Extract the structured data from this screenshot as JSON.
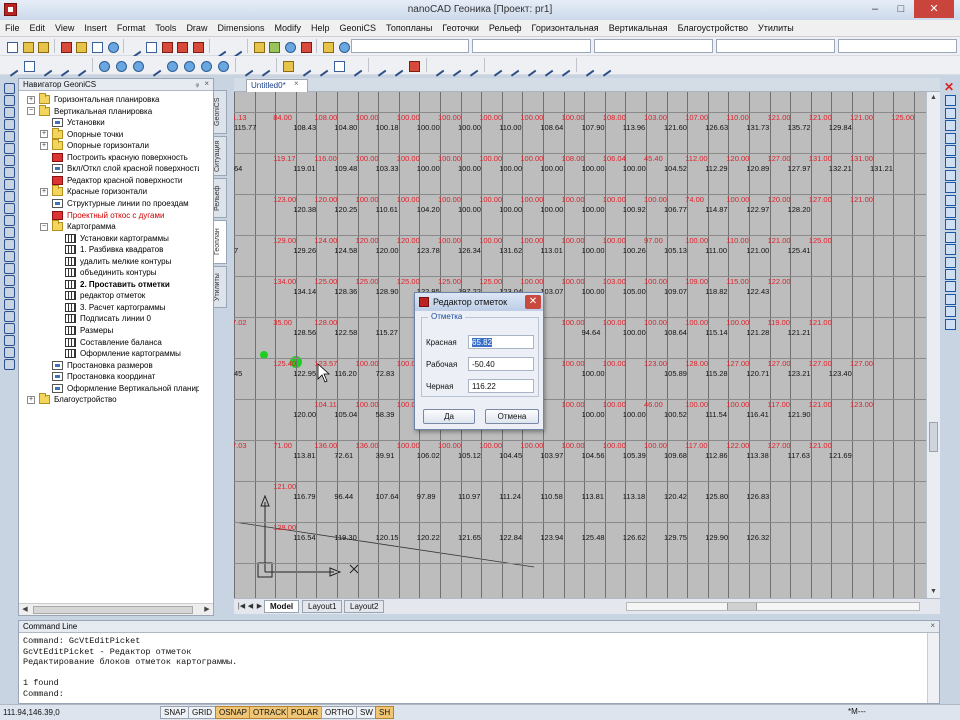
{
  "window": {
    "title": "nanoCAD Геоника [Проект: pr1]",
    "minimize": "–",
    "maximize": "□",
    "close": "✕"
  },
  "menu": [
    "File",
    "Edit",
    "View",
    "Insert",
    "Format",
    "Tools",
    "Draw",
    "Dimensions",
    "Modify",
    "Help",
    "GeoniCS",
    "Топопланы",
    "Геоточки",
    "Рельеф",
    "Горизонтальная",
    "Вертикальная",
    "Благоустройство",
    "Утилиты"
  ],
  "navigator": {
    "title": "Навигатор GeoniCS",
    "pin": "ᵩ",
    "close": "×",
    "items": [
      {
        "label": "Горизонтальная планировка",
        "level": 0,
        "exp": "+",
        "icon": "folder"
      },
      {
        "label": "Вертикальная планировка",
        "level": 0,
        "exp": "−",
        "icon": "folder"
      },
      {
        "label": "Установки",
        "level": 1,
        "exp": "",
        "icon": "tool"
      },
      {
        "label": "Опорные точки",
        "level": 1,
        "exp": "+",
        "icon": "folder"
      },
      {
        "label": "Опорные горизонтали",
        "level": 1,
        "exp": "+",
        "icon": "folder"
      },
      {
        "label": "Построить красную поверхность",
        "level": 1,
        "exp": "",
        "icon": "red"
      },
      {
        "label": "Вкл/Откл слой красной поверхности",
        "level": 1,
        "exp": "",
        "icon": "tool"
      },
      {
        "label": "Редактор красной поверхности",
        "level": 1,
        "exp": "",
        "icon": "red"
      },
      {
        "label": "Красные горизонтали",
        "level": 1,
        "exp": "+",
        "icon": "folder"
      },
      {
        "label": "Структурные линии по проездам",
        "level": 1,
        "exp": "",
        "icon": "tool"
      },
      {
        "label": "Проектный откос с дугами",
        "level": 1,
        "exp": "",
        "icon": "red",
        "style": "red"
      },
      {
        "label": "Картограмма",
        "level": 1,
        "exp": "−",
        "icon": "folder"
      },
      {
        "label": "Установки картограммы",
        "level": 2,
        "exp": "",
        "icon": "grid"
      },
      {
        "label": "1. Разбивка квадратов",
        "level": 2,
        "exp": "",
        "icon": "grid"
      },
      {
        "label": "удалить мелкие контуры",
        "level": 2,
        "exp": "",
        "icon": "grid"
      },
      {
        "label": "объединить контуры",
        "level": 2,
        "exp": "",
        "icon": "grid"
      },
      {
        "label": "2. Проставить отметки",
        "level": 2,
        "exp": "",
        "icon": "grid",
        "style": "selected"
      },
      {
        "label": "редактор отметок",
        "level": 2,
        "exp": "",
        "icon": "grid"
      },
      {
        "label": "3. Расчет картограммы",
        "level": 2,
        "exp": "",
        "icon": "grid"
      },
      {
        "label": "Подписать линии 0",
        "level": 2,
        "exp": "",
        "icon": "grid"
      },
      {
        "label": "Размеры",
        "level": 2,
        "exp": "",
        "icon": "grid"
      },
      {
        "label": "Составление баланса",
        "level": 2,
        "exp": "",
        "icon": "grid"
      },
      {
        "label": "Оформление картограммы",
        "level": 2,
        "exp": "",
        "icon": "grid"
      },
      {
        "label": "Простановка размеров",
        "level": 1,
        "exp": "",
        "icon": "tool"
      },
      {
        "label": "Простановка координат",
        "level": 1,
        "exp": "",
        "icon": "tool"
      },
      {
        "label": "Оформление Вертикальной планиров",
        "level": 1,
        "exp": "",
        "icon": "tool"
      },
      {
        "label": "Благоустройство",
        "level": 0,
        "exp": "+",
        "icon": "folder"
      }
    ]
  },
  "side_tabs": [
    "GeoniCS",
    "Ситуация",
    "Рельеф",
    "Геоплан",
    "Утилиты"
  ],
  "document_tab": {
    "label": "Untitled0*",
    "close": "×"
  },
  "layout_tabs": [
    "Model",
    "Layout1",
    "Layout2"
  ],
  "nav_arrows": [
    "|◀",
    "◀",
    "▶",
    "▶|"
  ],
  "grid": {
    "rows": [
      {
        "red": [
          "1.13",
          "84.00",
          "108.00",
          "100.00",
          "100.00",
          "100.00",
          "100.00",
          "100.00",
          "100.00",
          "108.00",
          "103.00",
          "107.00",
          "110.00",
          "121.00",
          "121.00",
          "121.00",
          "125.00"
        ],
        "blk": [
          "115.77",
          "108.43",
          "104.80",
          "100.18",
          "100.00",
          "100.00",
          "110.00",
          "108.64",
          "107.90",
          "113.96",
          "121.60",
          "126.63",
          "131.73",
          "135.72",
          "129.84"
        ]
      },
      {
        "red": [
          "",
          "119.17",
          "116.00",
          "100.00",
          "100.00",
          "100.00",
          "100.00",
          "100.00",
          "108.00",
          "106.04",
          "45.40",
          "112.00",
          "120.00",
          "127.00",
          "131.00",
          "131.00"
        ],
        "blk": [
          "64",
          "119.01",
          "109.48",
          "103.33",
          "100.00",
          "100.00",
          "100.00",
          "100.00",
          "100.00",
          "100.00",
          "104.52",
          "112.29",
          "120.89",
          "127.97",
          "132.21",
          "131.21"
        ]
      },
      {
        "red": [
          "",
          "123.00",
          "120.00",
          "100.00",
          "100.00",
          "100.00",
          "100.00",
          "100.00",
          "100.00",
          "100.00",
          "100.00",
          "74.00",
          "100.00",
          "120.00",
          "127.00",
          "121.00"
        ],
        "blk": [
          "",
          "120.38",
          "120.25",
          "110.61",
          "104.20",
          "100.00",
          "100.00",
          "100.00",
          "100.00",
          "100.92",
          "106.77",
          "114.87",
          "122.97",
          "128.20"
        ]
      },
      {
        "red": [
          "",
          "129.00",
          "124.00",
          "120.00",
          "120.00",
          "100.00",
          "100.00",
          "100.00",
          "100.00",
          "100.00",
          "97.00",
          "100.00",
          "110.00",
          "121.00",
          "125.00"
        ],
        "blk": [
          "7",
          "129.26",
          "124.58",
          "120.00",
          "123.78",
          "126.34",
          "131.62",
          "113.01",
          "100.00",
          "100.26",
          "105.13",
          "111.00",
          "121.00",
          "125.41"
        ]
      },
      {
        "red": [
          "",
          "134.00",
          "125.00",
          "125.00",
          "125.00",
          "125.00",
          "125.00",
          "100.00",
          "100.00",
          "103.00",
          "100.00",
          "109.00",
          "115.00",
          "122.00"
        ],
        "blk": [
          "",
          "134.14",
          "128.36",
          "128.90",
          "122.95",
          "197.22",
          "123.04",
          "103.07",
          "100.00",
          "105.00",
          "109.07",
          "118.82",
          "122.43"
        ]
      },
      {
        "red": [
          "7.02",
          "35.00",
          "128.00",
          "",
          "",
          "",
          "",
          "",
          "100.00",
          "100.00",
          "100.00",
          "100.00",
          "100.00",
          "119.00",
          "121.00"
        ],
        "blk": [
          "",
          "128.56",
          "122.58",
          "115.27",
          "",
          "",
          "",
          "",
          "94.64",
          "100.00",
          "108.64",
          "115.14",
          "121.28",
          "121.21"
        ]
      },
      {
        "red": [
          "",
          "125.40",
          "123.57",
          "100.00",
          "100.00",
          "100.00",
          "",
          "",
          "100.00",
          "100.00",
          "123.00",
          "128.00",
          "127.00",
          "127.00",
          "127.00",
          "127.00"
        ],
        "blk": [
          "45",
          "122.95",
          "116.20",
          "72.83",
          "",
          "",
          "",
          "",
          "100.00",
          "",
          "105.89",
          "115.28",
          "120.71",
          "123.21",
          "123.40"
        ]
      },
      {
        "red": [
          "",
          "",
          "104.11",
          "100.00",
          "100.00",
          "100.00",
          "100.00",
          "",
          "100.00",
          "100.00",
          "46.00",
          "100.00",
          "100.00",
          "117.00",
          "121.00",
          "123.00"
        ],
        "blk": [
          "",
          "120.00",
          "105.04",
          "58.39",
          "104.55",
          "",
          "100.00",
          "",
          "100.00",
          "100.00",
          "100.52",
          "111.54",
          "116.41",
          "121.90"
        ]
      },
      {
        "red": [
          "7.03",
          "71.00",
          "136.00",
          "136.00",
          "100.00",
          "100.00",
          "100.00",
          "100.00",
          "100.00",
          "100.00",
          "100.00",
          "117.00",
          "122.00",
          "127.00",
          "121.00"
        ],
        "blk": [
          "",
          "113.81",
          "72.61",
          "39.91",
          "106.02",
          "105.12",
          "104.45",
          "103.97",
          "104.56",
          "105.39",
          "109.68",
          "112.86",
          "113.38",
          "117.63",
          "121.69"
        ]
      },
      {
        "red": [
          "",
          "121.00",
          "",
          "",
          "",
          "",
          "",
          "",
          "",
          "",
          "",
          "",
          "",
          "",
          ""
        ],
        "blk": [
          "",
          "116.79",
          "96.44",
          "107.64",
          "97.89",
          "110.97",
          "111.24",
          "110.58",
          "113.81",
          "113.18",
          "120.42",
          "125.80",
          "126.83"
        ]
      },
      {
        "red": [
          "",
          "128.00",
          "",
          "",
          "",
          "",
          "",
          "",
          "",
          "",
          "",
          "",
          "",
          "",
          ""
        ],
        "blk": [
          "",
          "116.54",
          "119.30",
          "120.15",
          "120.22",
          "121.65",
          "122.84",
          "123.94",
          "125.48",
          "126.62",
          "129.75",
          "129.90",
          "126.32"
        ]
      }
    ]
  },
  "dialog": {
    "title": "Редактор отметок",
    "group": "Отметка",
    "fields": [
      {
        "label": "Красная",
        "value": "65.82"
      },
      {
        "label": "Рабочая",
        "value": "-50.40"
      },
      {
        "label": "Черная",
        "value": "116.22"
      }
    ],
    "ok": "Да",
    "cancel": "Отмена",
    "close": "✕"
  },
  "command_line": {
    "title": "Command Line",
    "lines": [
      "Command: GcVtEditPicket",
      "GcVtEditPicket - Редактор отметок",
      "Редактирование блоков отметок картограммы.",
      "",
      "1 found",
      "Command:"
    ]
  },
  "status": {
    "coords": "111.94,146.39,0",
    "buttons": [
      {
        "label": "SNAP",
        "on": false
      },
      {
        "label": "GRID",
        "on": false
      },
      {
        "label": "OSNAP",
        "on": true
      },
      {
        "label": "OTRACK",
        "on": true
      },
      {
        "label": "POLAR",
        "on": true
      },
      {
        "label": "ORTHO",
        "on": false
      },
      {
        "label": "SW",
        "on": false
      },
      {
        "label": "SH",
        "on": true
      }
    ],
    "right": "*M---"
  },
  "colors": {
    "red_mark": "#e0202a",
    "canvas": "#bdbdbd",
    "toggle_on": "#f0c676"
  }
}
